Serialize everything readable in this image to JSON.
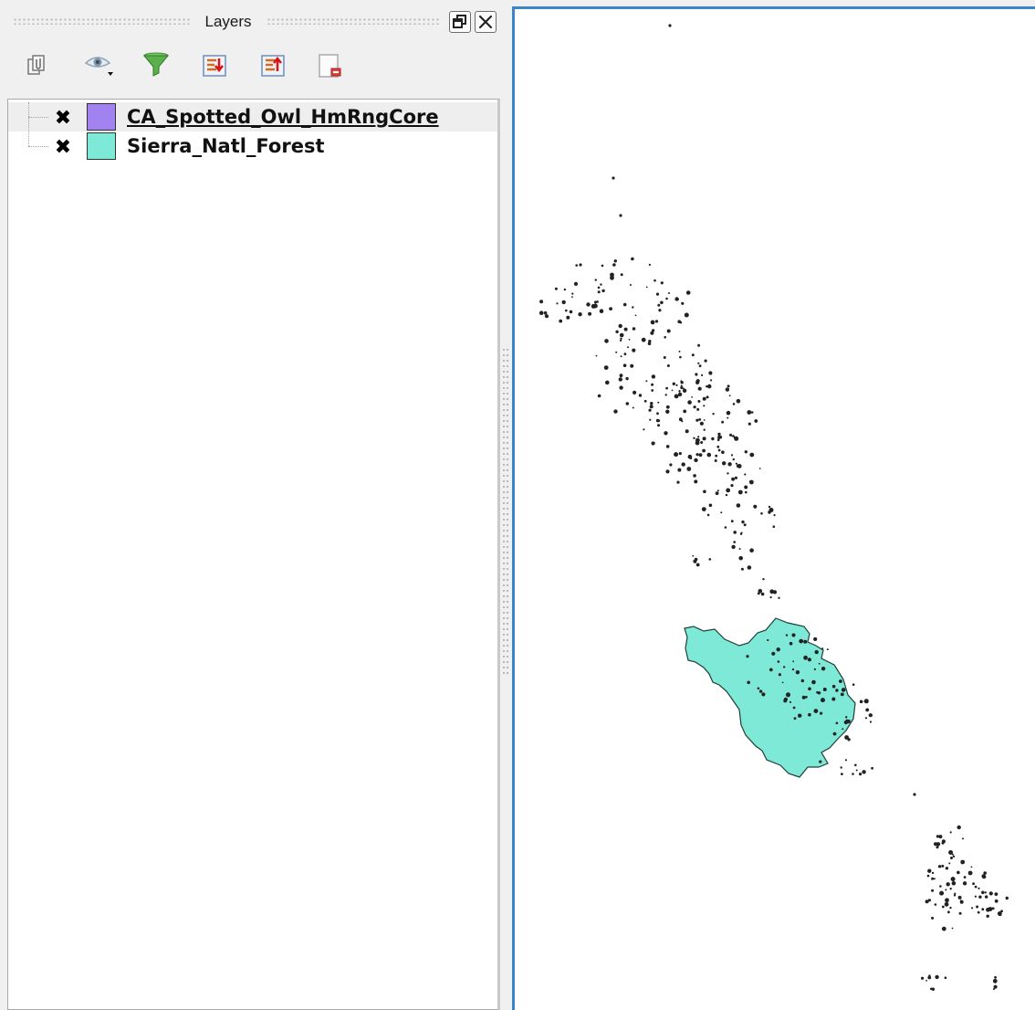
{
  "layers_panel": {
    "title": "Layers",
    "window_buttons": [
      "float-icon",
      "close-icon"
    ],
    "toolbar": [
      {
        "name": "add-group-button",
        "icon": "add-group-icon"
      },
      {
        "name": "manage-visibility-button",
        "icon": "eye-icon"
      },
      {
        "name": "filter-legend-button",
        "icon": "funnel-icon"
      },
      {
        "name": "expand-all-button",
        "icon": "expand-all-icon"
      },
      {
        "name": "collapse-all-button",
        "icon": "collapse-all-icon"
      },
      {
        "name": "remove-layer-button",
        "icon": "remove-layer-icon"
      }
    ],
    "layers": [
      {
        "name": "CA_Spotted_Owl_HmRngCore",
        "visible": true,
        "color": "#a182ee",
        "selected": true
      },
      {
        "name": "Sierra_Natl_Forest",
        "visible": true,
        "color": "#7fe9d7",
        "selected": false
      }
    ],
    "checkbox_glyph": "✖"
  },
  "map": {
    "background": "#ffffff",
    "border_color": "#3b86c9",
    "forest_fill": "#7fe9d7",
    "forest_stroke": "#1f3f3a",
    "owl_mark_color": "#222222"
  }
}
